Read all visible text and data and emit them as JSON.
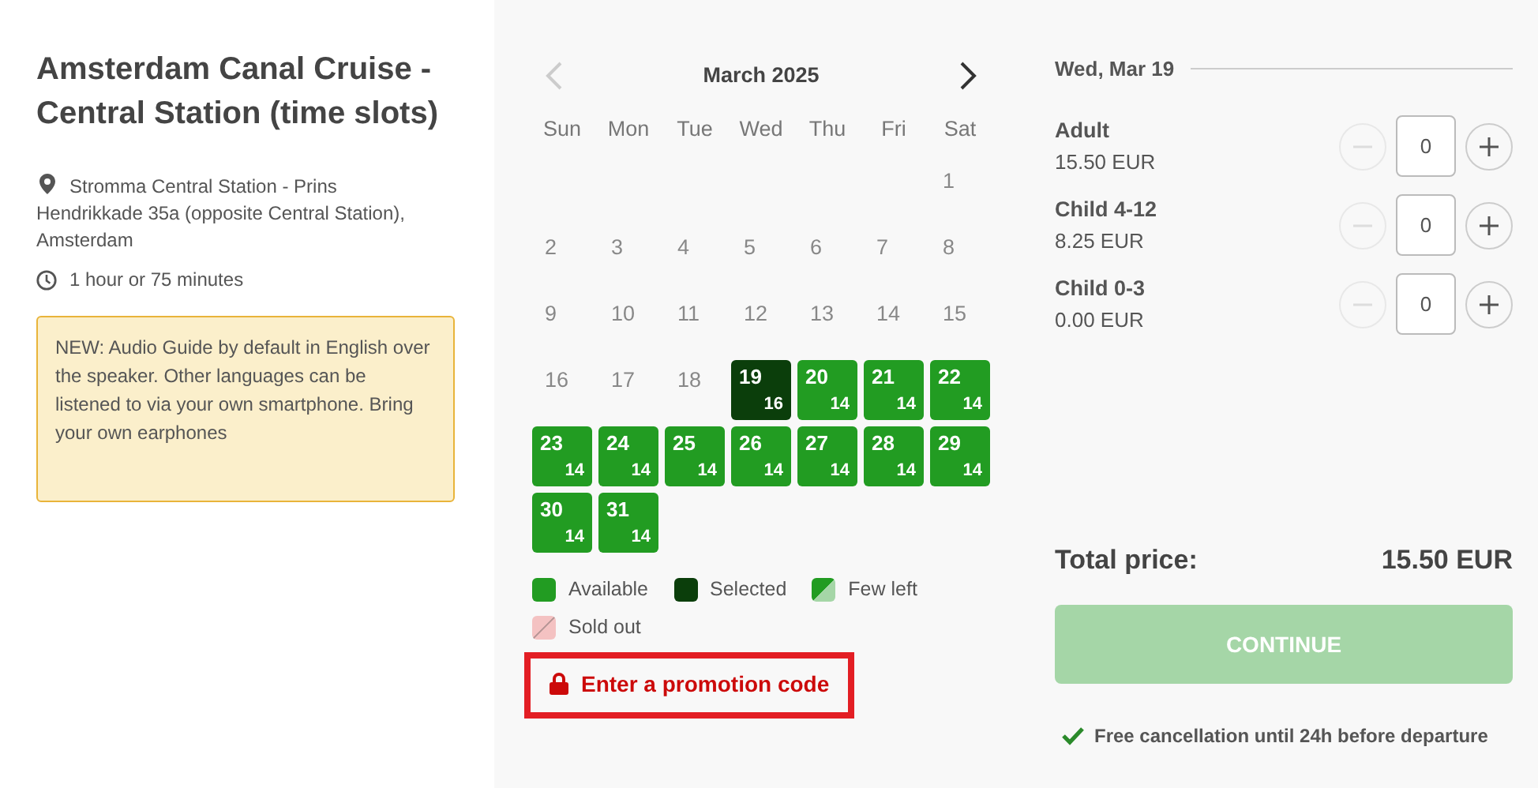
{
  "tour": {
    "title": "Amsterdam Canal Cruise - Central Station (time slots)",
    "location": "Stromma Central Station - Prins Hendrikkade 35a (opposite Central Station), Amsterdam",
    "duration": "1 hour or 75 minutes",
    "notice": "NEW: Audio Guide by default in English over the speaker. Other languages can be listened to via your own smartphone. Bring your own earphones"
  },
  "calendar": {
    "month": "March 2025",
    "prev_disabled": true,
    "weekdays": [
      "Sun",
      "Mon",
      "Tue",
      "Wed",
      "Thu",
      "Fri",
      "Sat"
    ],
    "weeks": [
      {
        "days": [
          {
            "day": "1",
            "kind": "plain",
            "selected": false
          }
        ]
      },
      {
        "days": [
          {
            "day": "2",
            "kind": "plain",
            "selected": false
          },
          {
            "day": "3",
            "kind": "plain",
            "selected": false
          },
          {
            "day": "4",
            "kind": "plain",
            "selected": false
          },
          {
            "day": "5",
            "kind": "plain",
            "selected": false
          },
          {
            "day": "6",
            "kind": "plain",
            "selected": false
          },
          {
            "day": "7",
            "kind": "plain",
            "selected": false
          },
          {
            "day": "8",
            "kind": "plain",
            "selected": false
          }
        ]
      },
      {
        "days": [
          {
            "day": "9",
            "kind": "plain",
            "selected": false
          },
          {
            "day": "10",
            "kind": "plain",
            "selected": false
          },
          {
            "day": "11",
            "kind": "plain",
            "selected": false
          },
          {
            "day": "12",
            "kind": "plain",
            "selected": false
          },
          {
            "day": "13",
            "kind": "plain",
            "selected": false
          },
          {
            "day": "14",
            "kind": "plain",
            "selected": false
          },
          {
            "day": "15",
            "kind": "plain",
            "selected": false
          }
        ]
      },
      {
        "days": [
          {
            "day": "16",
            "kind": "plain",
            "selected": false
          },
          {
            "day": "17",
            "kind": "plain",
            "selected": false
          },
          {
            "day": "18",
            "kind": "plain",
            "selected": false
          },
          {
            "day": "19",
            "kind": "slot",
            "count": "16",
            "selected": true
          },
          {
            "day": "20",
            "kind": "slot",
            "count": "14",
            "selected": false
          },
          {
            "day": "21",
            "kind": "slot",
            "count": "14",
            "selected": false
          },
          {
            "day": "22",
            "kind": "slot",
            "count": "14",
            "selected": false
          }
        ]
      },
      {
        "days": [
          {
            "day": "23",
            "kind": "slot",
            "count": "14",
            "selected": false
          },
          {
            "day": "24",
            "kind": "slot",
            "count": "14",
            "selected": false
          },
          {
            "day": "25",
            "kind": "slot",
            "count": "14",
            "selected": false
          },
          {
            "day": "26",
            "kind": "slot",
            "count": "14",
            "selected": false
          },
          {
            "day": "27",
            "kind": "slot",
            "count": "14",
            "selected": false
          },
          {
            "day": "28",
            "kind": "slot",
            "count": "14",
            "selected": false
          },
          {
            "day": "29",
            "kind": "slot",
            "count": "14",
            "selected": false
          }
        ]
      },
      {
        "days": [
          {
            "day": "30",
            "kind": "slot",
            "count": "14",
            "selected": false
          },
          {
            "day": "31",
            "kind": "slot",
            "count": "14",
            "selected": false
          }
        ]
      }
    ],
    "legend": [
      {
        "kind": "available",
        "label": "Available"
      },
      {
        "kind": "selected",
        "label": "Selected"
      },
      {
        "kind": "few",
        "label": "Few left"
      },
      {
        "kind": "soldout",
        "label": "Sold out"
      }
    ],
    "promo": {
      "label": "Enter a promotion code",
      "highlighted": true
    }
  },
  "booking": {
    "date": "Wed, Mar 19",
    "tickets": [
      {
        "name": "Adult",
        "price": "15.50 EUR",
        "value": "0",
        "minus_disabled": true
      },
      {
        "name": "Child 4-12",
        "price": "8.25 EUR",
        "value": "0",
        "minus_disabled": true
      },
      {
        "name": "Child 0-3",
        "price": "0.00 EUR",
        "value": "0",
        "minus_disabled": true
      }
    ],
    "total_label": "Total price:",
    "total": "15.50 EUR",
    "button": {
      "label": "CONTINUE",
      "disabled": true
    },
    "note": "Free cancellation until 24h before departure"
  }
}
